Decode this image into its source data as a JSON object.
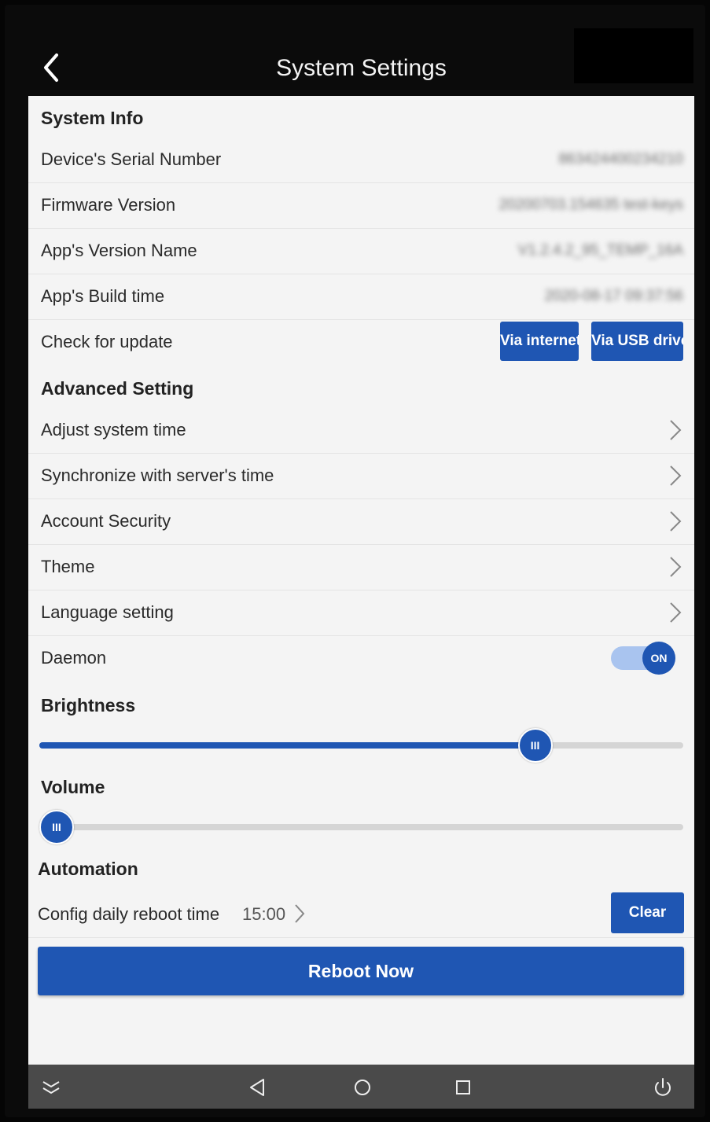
{
  "header": {
    "title": "System Settings"
  },
  "system_info": {
    "heading": "System Info",
    "rows": [
      {
        "label": "Device's Serial Number",
        "value": "863424400234210"
      },
      {
        "label": "Firmware Version",
        "value": "20200703.154635 test-keys"
      },
      {
        "label": "App's Version Name",
        "value": "V1.2.4.2_95_TEMP_16A"
      },
      {
        "label": "App's Build time",
        "value": "2020-08-17 09:37:56"
      }
    ],
    "update": {
      "label": "Check for update",
      "via_internet": "Via internet",
      "via_usb": "Via USB drive"
    }
  },
  "advanced": {
    "heading": "Advanced Setting",
    "items": [
      {
        "label": "Adjust system time"
      },
      {
        "label": "Synchronize with server's time"
      },
      {
        "label": "Account Security"
      },
      {
        "label": "Theme"
      },
      {
        "label": "Language setting"
      }
    ],
    "daemon": {
      "label": "Daemon",
      "state": "ON"
    }
  },
  "brightness": {
    "heading": "Brightness",
    "level_percent": 77,
    "thumb_glyph": "III"
  },
  "volume": {
    "heading": "Volume",
    "level_percent": 0,
    "thumb_glyph": "III"
  },
  "automation": {
    "heading": "Automation",
    "reboot_label": "Config daily reboot time",
    "reboot_time": "15:00",
    "clear_label": "Clear",
    "reboot_now_label": "Reboot Now"
  },
  "navbar": {
    "icons": [
      "collapse-icon",
      "back-triangle-icon",
      "home-circle-icon",
      "recents-square-icon",
      "power-icon"
    ]
  },
  "colors": {
    "accent": "#1f56b3",
    "accent_light": "#a9c4ef",
    "background": "#f4f4f4",
    "navbar": "#4a4a4a"
  }
}
